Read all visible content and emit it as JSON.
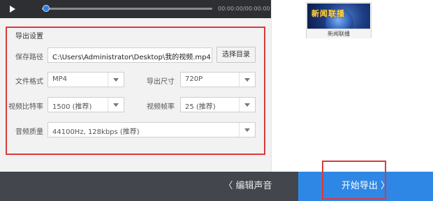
{
  "player": {
    "time": "00:00:00/00:00:00",
    "progress": 0.0
  },
  "export_settings": {
    "title": "导出设置",
    "save_path": {
      "label": "保存路径",
      "value": "C:\\Users\\Administrator\\Desktop\\我的视频.mp4",
      "browse_button": "选择目录"
    },
    "file_format": {
      "label": "文件格式",
      "value": "MP4"
    },
    "export_size": {
      "label": "导出尺寸",
      "value": "720P"
    },
    "video_bitrate": {
      "label": "视频比特率",
      "value": "1500 (推荐)"
    },
    "frame_rate": {
      "label": "视频帧率",
      "value": "25 (推荐)"
    },
    "audio_quality": {
      "label": "音频质量",
      "value": "44100Hz, 128kbps (推荐)"
    }
  },
  "thumbnail": {
    "logo_text": "新闻联播",
    "caption": "新闻联播"
  },
  "bottom": {
    "edit_audio_label": "〈 编辑声音",
    "export_label": "开始导出 〉"
  },
  "colors": {
    "accent_blue": "#2f87e5",
    "highlight_red": "#d93a3a",
    "player_bg": "#2e2f33",
    "bottom_bar_bg": "#43464c"
  }
}
